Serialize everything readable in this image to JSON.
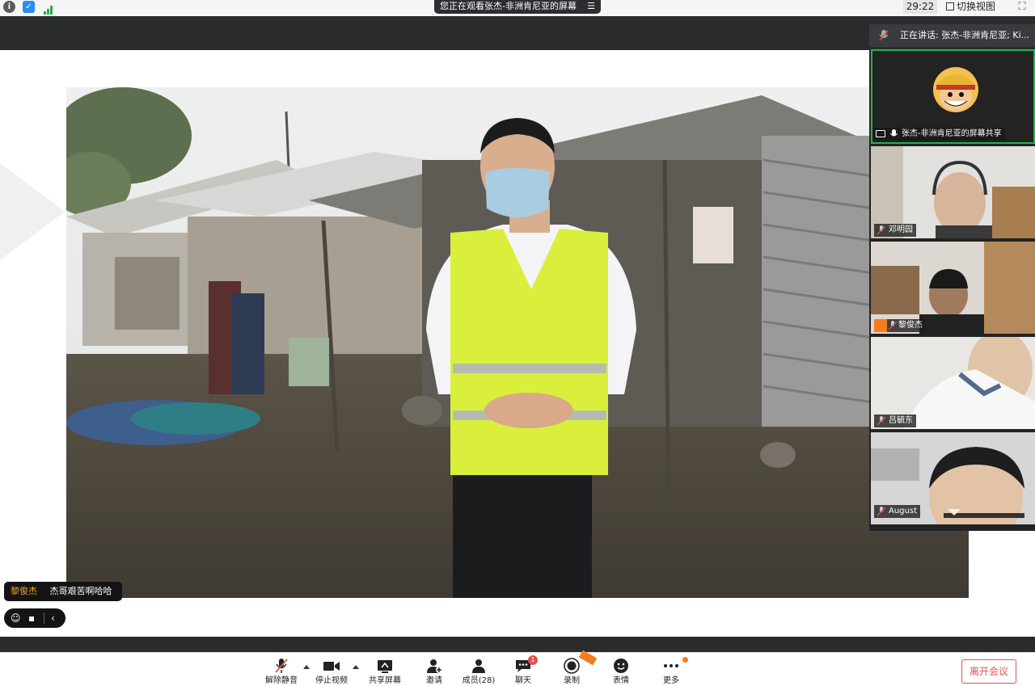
{
  "topbar": {
    "sharing_banner": "您正在观看张杰-非洲肯尼亚的屏幕",
    "timer": "29:22",
    "switch_view": "切换视图"
  },
  "speaking": "正在讲话: 张杰-非洲肯尼亚; Ki...",
  "participants": [
    {
      "name": "张杰-非洲肯尼亚的屏幕共享"
    },
    {
      "name": "邓明园"
    },
    {
      "name": "黎俊杰"
    },
    {
      "name": "吕毓东"
    },
    {
      "name": "August"
    }
  ],
  "chat": {
    "name": "黎俊杰",
    "message": "杰哥艰苦啊哈哈"
  },
  "toolbar": {
    "unmute": "解除静音",
    "stop_video": "停止视频",
    "share_screen": "共享屏幕",
    "invite": "邀请",
    "members": "成员(28)",
    "chat": "聊天",
    "chat_badge": "1",
    "record": "录制",
    "reactions": "表情",
    "more": "更多"
  },
  "leave": "离开会议",
  "colors": {
    "accent_green": "#27b04a",
    "leave_red": "#e0524f",
    "chat_name": "#f5a524"
  }
}
